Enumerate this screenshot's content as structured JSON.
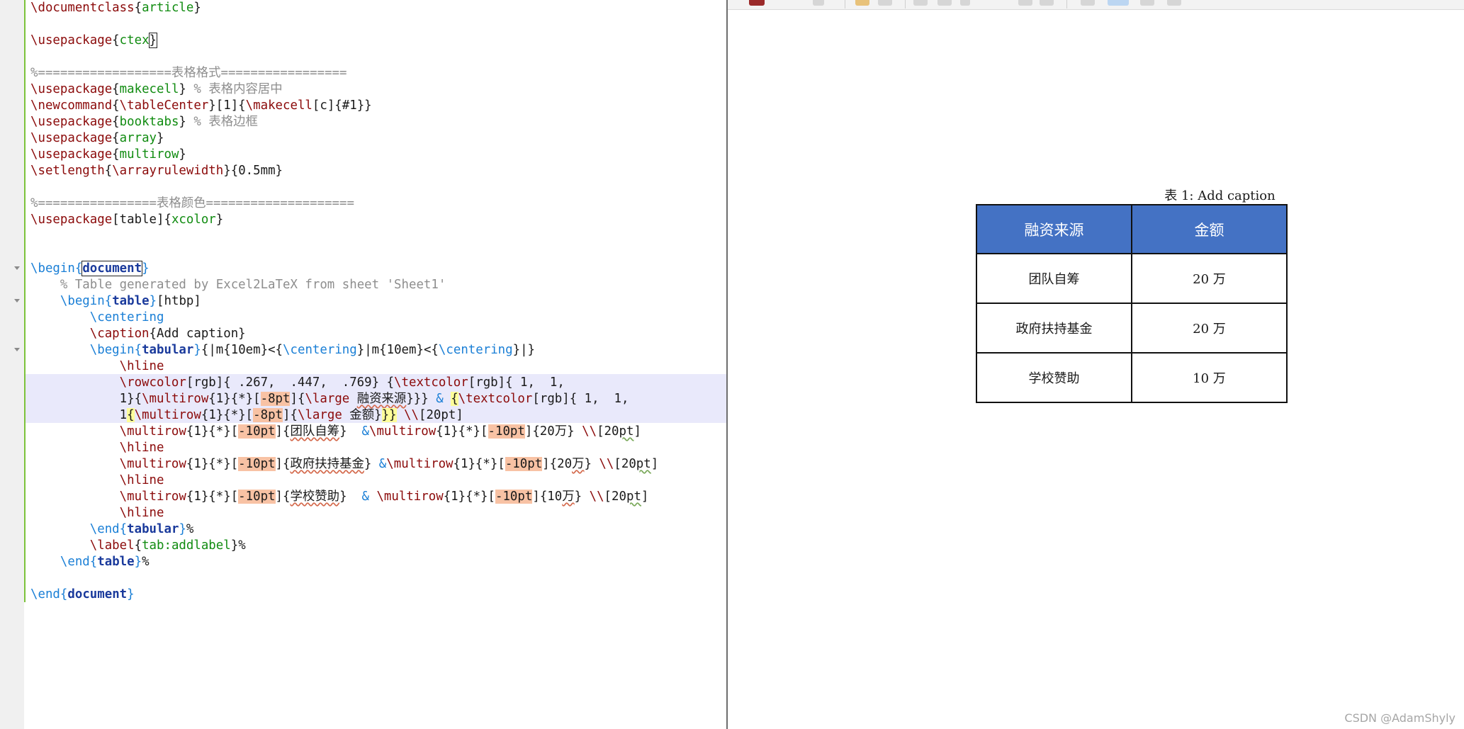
{
  "editor": {
    "lines": [
      [
        [
          "cmd",
          "\\documentclass"
        ],
        [
          "t",
          "{"
        ],
        [
          "arg",
          "article"
        ],
        [
          "t",
          "}"
        ]
      ],
      [],
      [
        [
          "cmd",
          "\\usepackage"
        ],
        [
          "t",
          "{"
        ],
        [
          "arg",
          "ctex"
        ],
        [
          "box",
          "}"
        ]
      ],
      [],
      [
        [
          "cmt",
          "%==================表格格式================="
        ]
      ],
      [
        [
          "cmd",
          "\\usepackage"
        ],
        [
          "t",
          "{"
        ],
        [
          "arg",
          "makecell"
        ],
        [
          "t",
          "} "
        ],
        [
          "cmt",
          "% 表格内容居中"
        ]
      ],
      [
        [
          "cmd",
          "\\newcommand"
        ],
        [
          "t",
          "{"
        ],
        [
          "cmd",
          "\\tableCenter"
        ],
        [
          "t",
          "}[1]{"
        ],
        [
          "cmd",
          "\\makecell"
        ],
        [
          "t",
          "[c]{#1}}"
        ]
      ],
      [
        [
          "cmd",
          "\\usepackage"
        ],
        [
          "t",
          "{"
        ],
        [
          "arg",
          "booktabs"
        ],
        [
          "t",
          "} "
        ],
        [
          "cmt",
          "% 表格边框"
        ]
      ],
      [
        [
          "cmd",
          "\\usepackage"
        ],
        [
          "t",
          "{"
        ],
        [
          "arg",
          "array"
        ],
        [
          "t",
          "}"
        ]
      ],
      [
        [
          "cmd",
          "\\usepackage"
        ],
        [
          "t",
          "{"
        ],
        [
          "arg",
          "multirow"
        ],
        [
          "t",
          "}"
        ]
      ],
      [
        [
          "cmd",
          "\\setlength"
        ],
        [
          "t",
          "{"
        ],
        [
          "cmd",
          "\\arrayrulewidth"
        ],
        [
          "t",
          "}{0.5mm}"
        ]
      ],
      [],
      [
        [
          "cmt",
          "%================表格颜色===================="
        ]
      ],
      [
        [
          "cmd",
          "\\usepackage"
        ],
        [
          "t",
          "[table]{"
        ],
        [
          "arg",
          "xcolor"
        ],
        [
          "t",
          "}"
        ]
      ],
      [],
      [],
      [
        [
          "env",
          "\\begin"
        ],
        [
          "env",
          "{"
        ],
        [
          "ebox",
          "document"
        ],
        [
          "env",
          "}"
        ]
      ],
      [
        [
          "t",
          "    "
        ],
        [
          "cmt",
          "% Table generated by Excel2LaTeX from sheet 'Sheet1'"
        ]
      ],
      [
        [
          "t",
          "    "
        ],
        [
          "env",
          "\\begin"
        ],
        [
          "env",
          "{"
        ],
        [
          "ename",
          "table"
        ],
        [
          "env",
          "}"
        ],
        [
          "t",
          "[htbp]"
        ]
      ],
      [
        [
          "t",
          "        "
        ],
        [
          "env",
          "\\centering"
        ]
      ],
      [
        [
          "t",
          "        "
        ],
        [
          "cmd",
          "\\caption"
        ],
        [
          "t",
          "{Add caption}"
        ]
      ],
      [
        [
          "t",
          "        "
        ],
        [
          "env",
          "\\begin"
        ],
        [
          "env",
          "{"
        ],
        [
          "ename",
          "tabular"
        ],
        [
          "env",
          "}"
        ],
        [
          "t",
          "{|m{10em}<{"
        ],
        [
          "env",
          "\\centering"
        ],
        [
          "t",
          "}|m{10em}<{"
        ],
        [
          "env",
          "\\centering"
        ],
        [
          "t",
          "}|}"
        ]
      ],
      [
        [
          "t",
          "            "
        ],
        [
          "cmd",
          "\\hline"
        ]
      ],
      [
        [
          "t",
          "            "
        ],
        [
          "cmd",
          "\\rowcolor"
        ],
        [
          "t",
          "[rgb]{ .267,  .447,  .769} {"
        ],
        [
          "cmd",
          "\\textcolor"
        ],
        [
          "t",
          "[rgb]{ 1,  1,"
        ]
      ],
      [
        [
          "t",
          "            1}{"
        ],
        [
          "cmd",
          "\\multirow"
        ],
        [
          "t",
          "{1}{*}["
        ],
        [
          "hl",
          "-8pt"
        ],
        [
          "t",
          "]{"
        ],
        [
          "cmd",
          "\\large"
        ],
        [
          "t",
          " "
        ],
        [
          "sq",
          "融资来源"
        ],
        [
          "t",
          "}}} "
        ],
        [
          "env",
          "&"
        ],
        [
          "t",
          " "
        ],
        [
          "br",
          "{"
        ],
        [
          "cmd",
          "\\textcolor"
        ],
        [
          "t",
          "[rgb]{ 1,  1,"
        ]
      ],
      [
        [
          "t",
          "            1"
        ],
        [
          "br",
          "{"
        ],
        [
          "cmd",
          "\\multirow"
        ],
        [
          "t",
          "{1}{*}["
        ],
        [
          "hl",
          "-8pt"
        ],
        [
          "t",
          "]{"
        ],
        [
          "cmd",
          "\\large"
        ],
        [
          "t",
          " "
        ],
        [
          "cj",
          "金额"
        ],
        [
          "t",
          "}"
        ],
        [
          "br",
          "}}"
        ],
        [
          "t",
          " "
        ],
        [
          "cmd",
          "\\\\"
        ],
        [
          "t",
          "[20pt]"
        ]
      ],
      [
        [
          "t",
          "            "
        ],
        [
          "cmd",
          "\\multirow"
        ],
        [
          "t",
          "{1}{*}["
        ],
        [
          "hl",
          "-10pt"
        ],
        [
          "t",
          "]{"
        ],
        [
          "sq",
          "团队自筹"
        ],
        [
          "t",
          "}  "
        ],
        [
          "env",
          "&"
        ],
        [
          "cmd",
          "\\multirow"
        ],
        [
          "t",
          "{1}{*}["
        ],
        [
          "hl",
          "-10pt"
        ],
        [
          "t",
          "]{20"
        ],
        [
          "cj",
          "万"
        ],
        [
          "t",
          "} "
        ],
        [
          "cmd",
          "\\\\"
        ],
        [
          "t",
          "[20"
        ],
        [
          "sq2",
          "pt"
        ],
        [
          "t",
          "]"
        ]
      ],
      [
        [
          "t",
          "            "
        ],
        [
          "cmd",
          "\\hline"
        ]
      ],
      [
        [
          "t",
          "            "
        ],
        [
          "cmd",
          "\\multirow"
        ],
        [
          "t",
          "{1}{*}["
        ],
        [
          "hl",
          "-10pt"
        ],
        [
          "t",
          "]{"
        ],
        [
          "sq",
          "政府扶持基金"
        ],
        [
          "t",
          "} "
        ],
        [
          "env",
          "&"
        ],
        [
          "cmd",
          "\\multirow"
        ],
        [
          "t",
          "{1}{*}["
        ],
        [
          "hl",
          "-10pt"
        ],
        [
          "t",
          "]{20"
        ],
        [
          "sq",
          "万"
        ],
        [
          "t",
          "} "
        ],
        [
          "cmd",
          "\\\\"
        ],
        [
          "t",
          "[20"
        ],
        [
          "sq2",
          "pt"
        ],
        [
          "t",
          "]"
        ]
      ],
      [
        [
          "t",
          "            "
        ],
        [
          "cmd",
          "\\hline"
        ]
      ],
      [
        [
          "t",
          "            "
        ],
        [
          "cmd",
          "\\multirow"
        ],
        [
          "t",
          "{1}{*}["
        ],
        [
          "hl",
          "-10pt"
        ],
        [
          "t",
          "]{"
        ],
        [
          "sq",
          "学校赞助"
        ],
        [
          "t",
          "}  "
        ],
        [
          "env",
          "&"
        ],
        [
          "t",
          " "
        ],
        [
          "cmd",
          "\\multirow"
        ],
        [
          "t",
          "{1}{*}["
        ],
        [
          "hl",
          "-10pt"
        ],
        [
          "t",
          "]{10"
        ],
        [
          "sq",
          "万"
        ],
        [
          "t",
          "} "
        ],
        [
          "cmd",
          "\\\\"
        ],
        [
          "t",
          "[20"
        ],
        [
          "sq2",
          "pt"
        ],
        [
          "t",
          "]"
        ]
      ],
      [
        [
          "t",
          "            "
        ],
        [
          "cmd",
          "\\hline"
        ]
      ],
      [
        [
          "t",
          "        "
        ],
        [
          "env",
          "\\end"
        ],
        [
          "env",
          "{"
        ],
        [
          "ename",
          "tabular"
        ],
        [
          "env",
          "}"
        ],
        [
          "t",
          "%"
        ]
      ],
      [
        [
          "t",
          "        "
        ],
        [
          "cmd",
          "\\label"
        ],
        [
          "t",
          "{"
        ],
        [
          "arg",
          "tab:addlabel"
        ],
        [
          "t",
          "}%"
        ]
      ],
      [
        [
          "t",
          "    "
        ],
        [
          "env",
          "\\end"
        ],
        [
          "env",
          "{"
        ],
        [
          "ename",
          "table"
        ],
        [
          "env",
          "}"
        ],
        [
          "t",
          "%"
        ]
      ],
      [],
      [
        [
          "env",
          "\\end"
        ],
        [
          "env",
          "{"
        ],
        [
          "ename",
          "document"
        ],
        [
          "env",
          "}"
        ]
      ]
    ]
  },
  "preview": {
    "caption": "表 1: Add caption",
    "table": {
      "header": [
        "融资来源",
        "金额"
      ],
      "rows": [
        [
          "团队自筹",
          "20 万"
        ],
        [
          "政府扶持基金",
          "20 万"
        ],
        [
          "学校赞助",
          "10 万"
        ]
      ],
      "header_bg": "#4472c4",
      "header_text_color": "#ffffff"
    }
  },
  "watermark": "CSDN @AdamShyly"
}
